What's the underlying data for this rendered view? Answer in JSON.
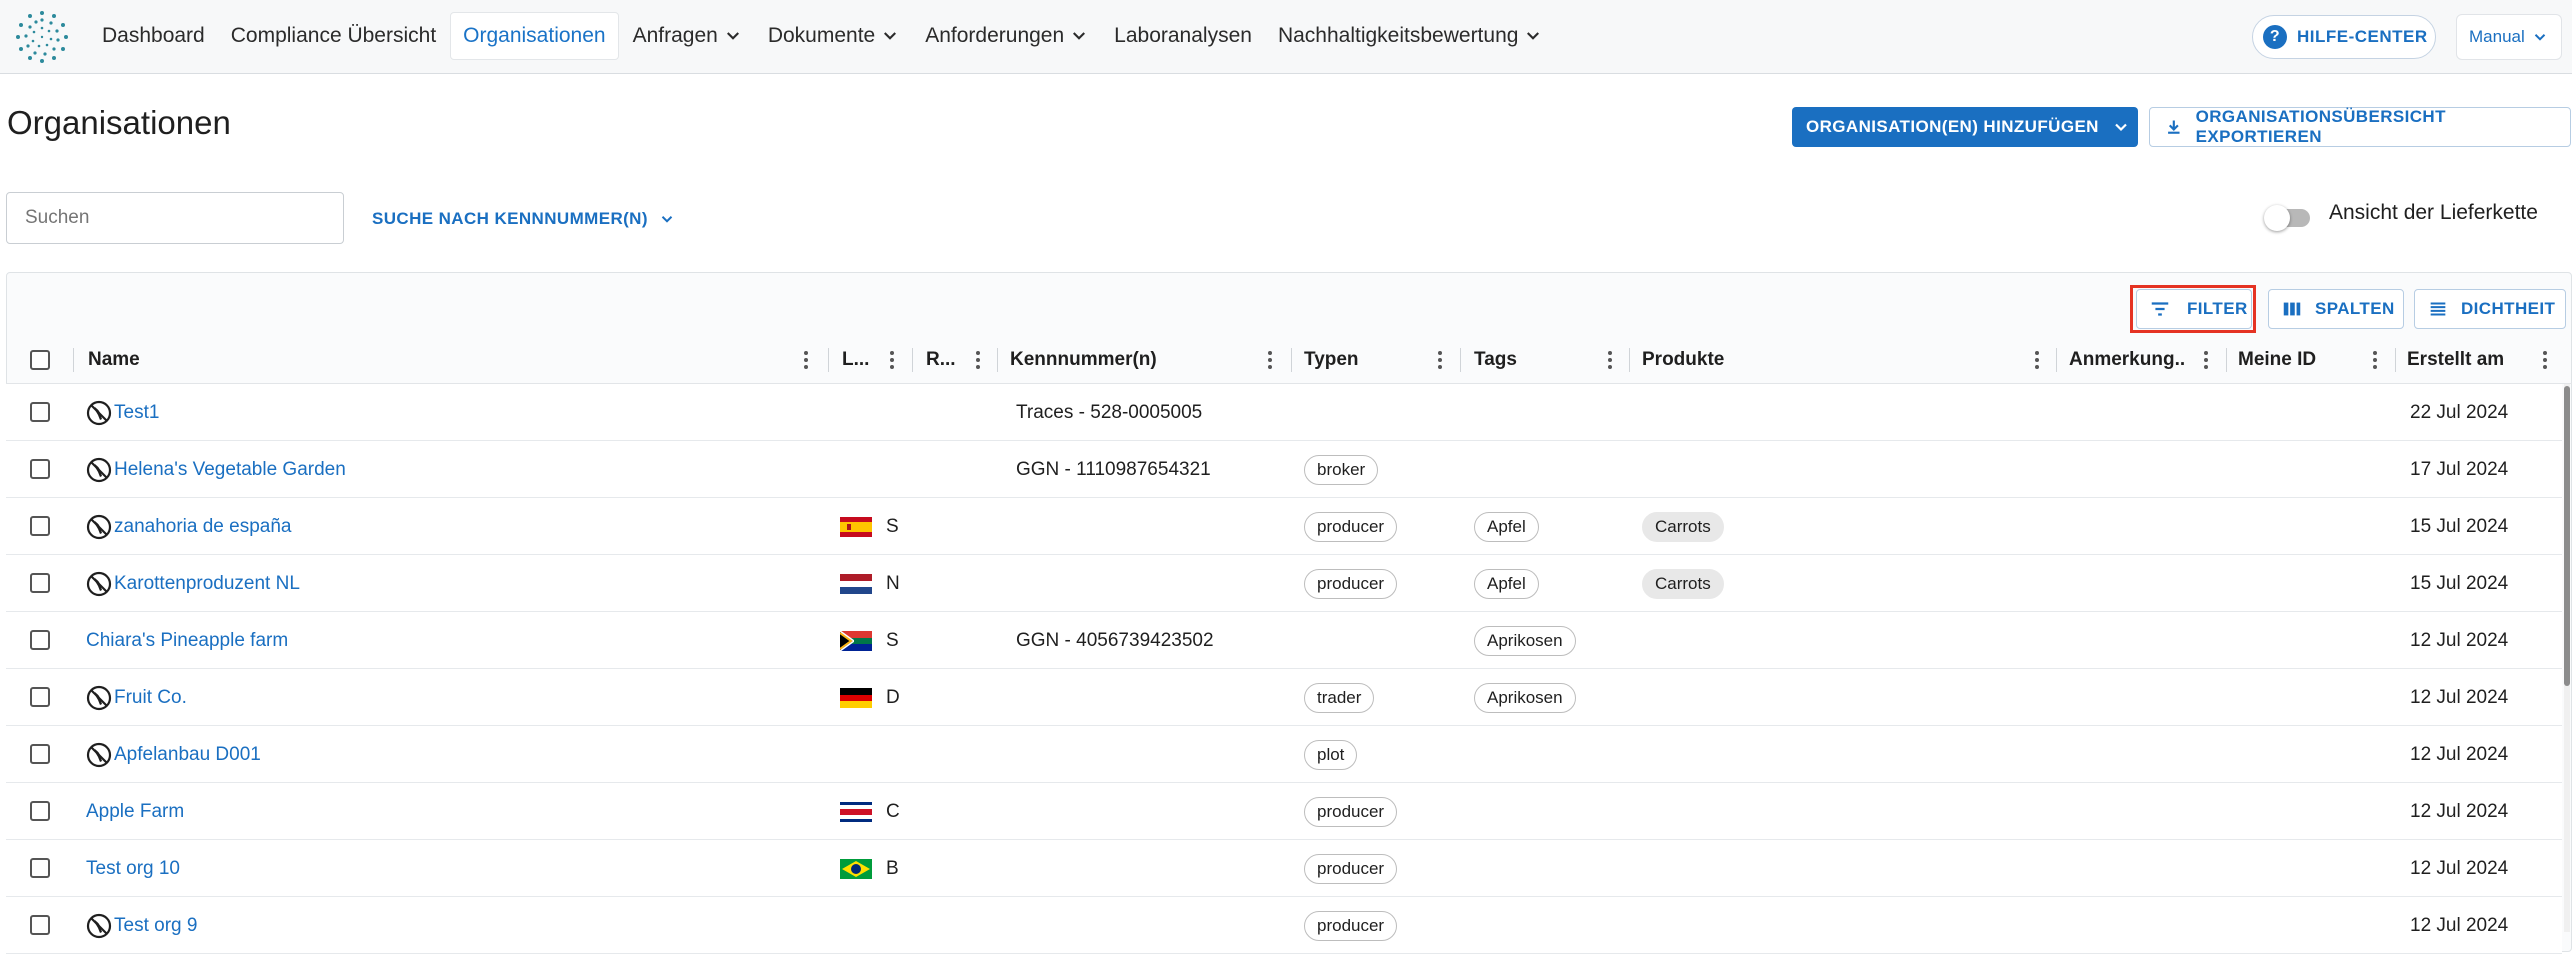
{
  "nav": {
    "items": [
      {
        "label": "Dashboard",
        "has_dropdown": false,
        "active": false
      },
      {
        "label": "Compliance Übersicht",
        "has_dropdown": false,
        "active": false
      },
      {
        "label": "Organisationen",
        "has_dropdown": false,
        "active": true
      },
      {
        "label": "Anfragen",
        "has_dropdown": true,
        "active": false
      },
      {
        "label": "Dokumente",
        "has_dropdown": true,
        "active": false
      },
      {
        "label": "Anforderungen",
        "has_dropdown": true,
        "active": false
      },
      {
        "label": "Laboranalysen",
        "has_dropdown": false,
        "active": false
      },
      {
        "label": "Nachhaltigkeitsbewertung",
        "has_dropdown": true,
        "active": false
      }
    ],
    "help_label": "HILFE-CENTER",
    "manual_label": "Manual"
  },
  "page": {
    "title": "Organisationen",
    "add_button": "ORGANISATION(EN) HINZUFÜGEN",
    "export_button": "ORGANISATIONSÜBERSICHT EXPORTIEREN",
    "search_placeholder": "Suchen",
    "search_by_button": "SUCHE NACH KENNNUMMER(N)",
    "supply_chain_toggle_label": "Ansicht der Lieferkette",
    "supply_chain_toggle_on": false
  },
  "toolbar": {
    "filter": "FILTER",
    "columns": "SPALTEN",
    "density": "DICHTHEIT"
  },
  "colors": {
    "accent": "#1a6fc1",
    "highlight": "#e53323"
  },
  "table": {
    "columns": [
      {
        "key": "name",
        "label": "Name"
      },
      {
        "key": "land",
        "label": "L..."
      },
      {
        "key": "region",
        "label": "R..."
      },
      {
        "key": "ids",
        "label": "Kennnummer(n)"
      },
      {
        "key": "types",
        "label": "Typen"
      },
      {
        "key": "tags",
        "label": "Tags"
      },
      {
        "key": "products",
        "label": "Produkte"
      },
      {
        "key": "notes",
        "label": "Anmerkung..."
      },
      {
        "key": "my_id",
        "label": "Meine ID"
      },
      {
        "key": "created",
        "label": "Erstellt am"
      }
    ],
    "rows": [
      {
        "blocked": true,
        "name": "Test1",
        "flag": "",
        "region": "",
        "ids": "Traces - 528-0005005",
        "types": "",
        "tags": "",
        "products": "",
        "created": "22 Jul 2024"
      },
      {
        "blocked": true,
        "name": "Helena's Vegetable Garden",
        "flag": "",
        "region": "",
        "ids": "GGN - 1110987654321",
        "types": "broker",
        "tags": "",
        "products": "",
        "created": "17 Jul 2024"
      },
      {
        "blocked": true,
        "name": "zanahoria de españa",
        "flag": "es",
        "region": "S",
        "ids": "",
        "types": "producer",
        "tags": "Apfel",
        "products": "Carrots",
        "created": "15 Jul 2024"
      },
      {
        "blocked": true,
        "name": "Karottenproduzent NL",
        "flag": "nl",
        "region": "N",
        "ids": "",
        "types": "producer",
        "tags": "Apfel",
        "products": "Carrots",
        "created": "15 Jul 2024"
      },
      {
        "blocked": false,
        "name": "Chiara's Pineapple farm",
        "flag": "za",
        "region": "S",
        "ids": "GGN - 4056739423502",
        "types": "",
        "tags": "Aprikosen",
        "products": "",
        "created": "12 Jul 2024"
      },
      {
        "blocked": true,
        "name": "Fruit Co.",
        "flag": "de",
        "region": "D",
        "ids": "",
        "types": "trader",
        "tags": "Aprikosen",
        "products": "",
        "created": "12 Jul 2024"
      },
      {
        "blocked": true,
        "name": "Apfelanbau D001",
        "flag": "",
        "region": "",
        "ids": "",
        "types": "plot",
        "tags": "",
        "products": "",
        "created": "12 Jul 2024"
      },
      {
        "blocked": false,
        "name": "Apple Farm",
        "flag": "cr",
        "region": "C",
        "ids": "",
        "types": "producer",
        "tags": "",
        "products": "",
        "created": "12 Jul 2024"
      },
      {
        "blocked": false,
        "name": "Test org 10",
        "flag": "br",
        "region": "B",
        "ids": "",
        "types": "producer",
        "tags": "",
        "products": "",
        "created": "12 Jul 2024"
      },
      {
        "blocked": true,
        "name": "Test org 9",
        "flag": "",
        "region": "",
        "ids": "",
        "types": "producer",
        "tags": "",
        "products": "",
        "created": "12 Jul 2024"
      }
    ]
  }
}
